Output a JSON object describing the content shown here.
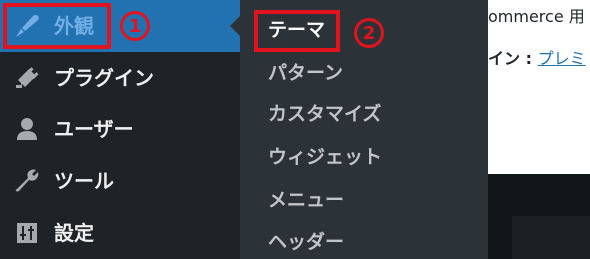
{
  "sidebar": {
    "items": [
      {
        "label": "外観",
        "icon": "paintbrush-icon",
        "active": true
      },
      {
        "label": "プラグイン",
        "icon": "plugin-icon"
      },
      {
        "label": "ユーザー",
        "icon": "user-icon"
      },
      {
        "label": "ツール",
        "icon": "wrench-icon"
      },
      {
        "label": "設定",
        "icon": "settings-sliders-icon"
      }
    ]
  },
  "submenu": {
    "items": [
      {
        "label": "テーマ",
        "current": true
      },
      {
        "label": "パターン"
      },
      {
        "label": "カスタマイズ"
      },
      {
        "label": "ウィジェット"
      },
      {
        "label": "メニュー"
      },
      {
        "label": "ヘッダー"
      }
    ]
  },
  "annotations": {
    "badge_1": "1",
    "badge_2": "2",
    "highlight_color": "#e2131c"
  },
  "background": {
    "line1": "ommerce 用",
    "line2_prefix": "イン :",
    "line2_link": "プレミ"
  },
  "colors": {
    "sidebar_bg": "#1d2327",
    "submenu_bg": "#2c3338",
    "active_bg": "#2271b1",
    "active_text": "#72aee6"
  }
}
